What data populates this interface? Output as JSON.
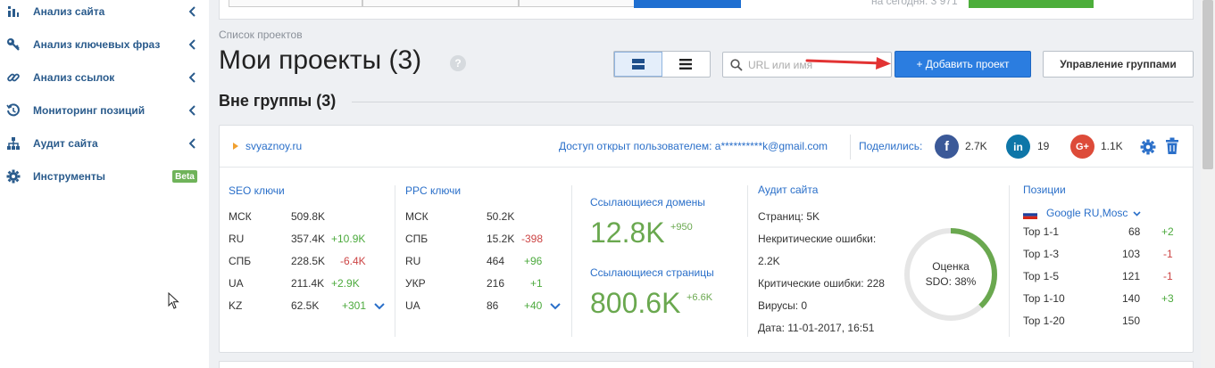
{
  "sidebar": {
    "items": [
      {
        "label": "Анализ сайта",
        "icon": "chart-icon"
      },
      {
        "label": "Анализ ключевых фраз",
        "icon": "key-icon"
      },
      {
        "label": "Анализ ссылок",
        "icon": "link-icon"
      },
      {
        "label": "Мониторинг позиций",
        "icon": "history-icon"
      },
      {
        "label": "Аудит сайта",
        "icon": "sitemap-icon"
      },
      {
        "label": "Инструменты",
        "icon": "gear-icon",
        "badge": "Beta"
      }
    ]
  },
  "top": {
    "today_text": "на сегодня: 3 971"
  },
  "header": {
    "breadcrumb": "Список проектов",
    "title": "Мои проекты (3)",
    "help": "?",
    "search_placeholder": "URL или имя",
    "add_button": "+ Добавить проект",
    "manage_button": "Управление группами"
  },
  "group": {
    "title": "Вне группы (3)"
  },
  "project": {
    "domain": "svyaznoy.ru",
    "access": "Доступ открыт пользователем: a**********k@gmail.com",
    "share_label": "Поделились:",
    "social": [
      {
        "name": "facebook",
        "glyph": "f",
        "count": "2.7K",
        "color": "#3b5998"
      },
      {
        "name": "linkedin",
        "glyph": "in",
        "count": "19",
        "color": "#0e76a8"
      },
      {
        "name": "google-plus",
        "glyph": "G+",
        "count": "1.1K",
        "color": "#dd4b39"
      }
    ],
    "seo": {
      "title": "SEO ключи",
      "rows": [
        {
          "region": "МСК",
          "value": "509.8K",
          "delta": "",
          "sign": ""
        },
        {
          "region": "RU",
          "value": "357.4K",
          "delta": "+10.9K",
          "sign": "pos"
        },
        {
          "region": "СПБ",
          "value": "228.5K",
          "delta": "-6.4K",
          "sign": "neg"
        },
        {
          "region": "UA",
          "value": "211.4K",
          "delta": "+2.9K",
          "sign": "pos"
        },
        {
          "region": "KZ",
          "value": "62.5K",
          "delta": "+301",
          "sign": "pos"
        }
      ]
    },
    "ppc": {
      "title": "PPC ключи",
      "rows": [
        {
          "region": "МСК",
          "value": "50.2K",
          "delta": "",
          "sign": ""
        },
        {
          "region": "СПБ",
          "value": "15.2K",
          "delta": "-398",
          "sign": "neg"
        },
        {
          "region": "RU",
          "value": "464",
          "delta": "+96",
          "sign": "pos"
        },
        {
          "region": "УКР",
          "value": "216",
          "delta": "+1",
          "sign": "pos"
        },
        {
          "region": "UA",
          "value": "86",
          "delta": "+40",
          "sign": "pos"
        }
      ]
    },
    "links": {
      "domains_title": "Ссылающиеся домены",
      "domains_value": "12.8K",
      "domains_delta": "+950",
      "pages_title": "Ссылающиеся страницы",
      "pages_value": "800.6K",
      "pages_delta": "+6.6K"
    },
    "audit": {
      "title": "Аудит сайта",
      "pages": "Страниц: 5K",
      "noncritical_label": "Некритические ошибки:",
      "noncritical_value": "2.2K",
      "critical": "Критические ошибки: 228",
      "viruses": "Вирусы: 0",
      "date": "Дата: 11-01-2017, 16:51",
      "sdo_label": "Оценка",
      "sdo_value": "SDO: 38%",
      "sdo_fraction": 0.38
    },
    "positions": {
      "title": "Позиции",
      "engine": "Google RU,Mosc",
      "rows": [
        {
          "label": "Top 1-1",
          "value": "68",
          "delta": "+2",
          "sign": "pos"
        },
        {
          "label": "Top 1-3",
          "value": "103",
          "delta": "-1",
          "sign": "neg"
        },
        {
          "label": "Top 1-5",
          "value": "121",
          "delta": "-1",
          "sign": "neg"
        },
        {
          "label": "Top 1-10",
          "value": "140",
          "delta": "+3",
          "sign": "pos"
        },
        {
          "label": "Top 1-20",
          "value": "150",
          "delta": "",
          "sign": ""
        }
      ]
    }
  },
  "colors": {
    "accent": "#2b7de0",
    "link": "#2a6fc9",
    "positive": "#4caa3d",
    "negative": "#cc4444",
    "badge": "#6fb35a"
  }
}
